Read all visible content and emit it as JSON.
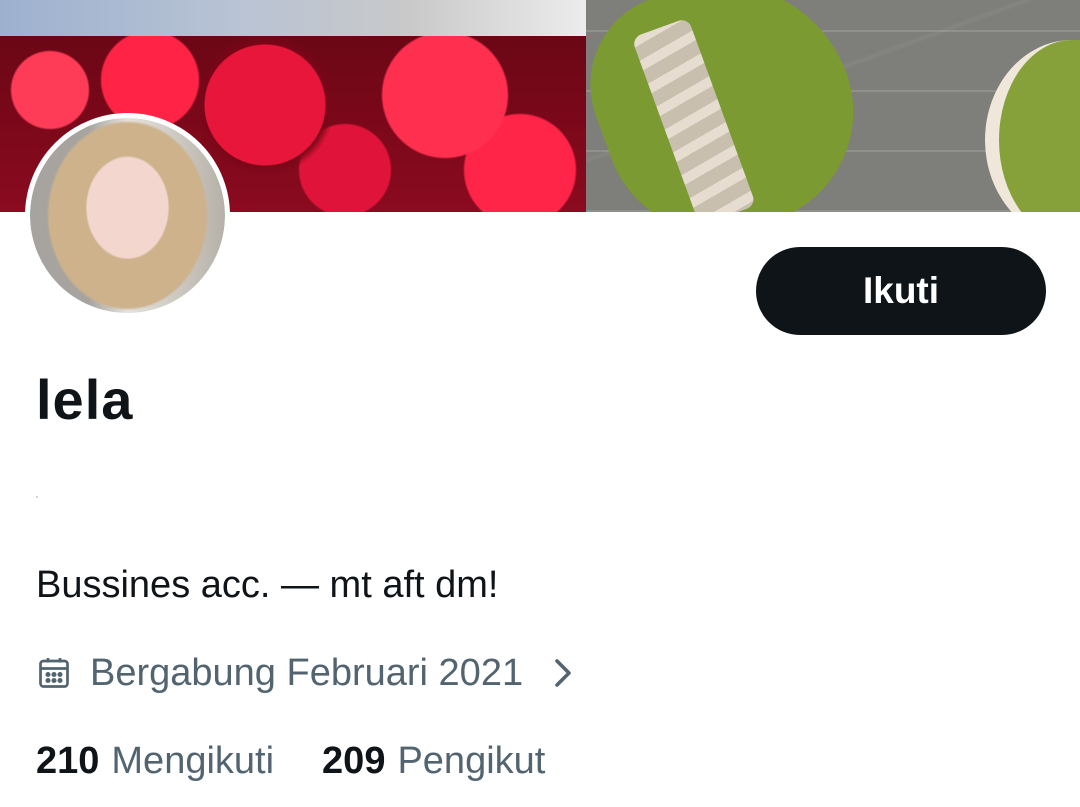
{
  "profile": {
    "display_name": "lela",
    "bio": "Bussines acc. — mt aft dm!",
    "joined": "Bergabung Februari 2021",
    "follow_label": "Ikuti"
  },
  "stats": {
    "following_count": "210",
    "following_label": "Mengikuti",
    "followers_count": "209",
    "followers_label": "Pengikut"
  },
  "icons": {
    "calendar": "calendar-icon",
    "chevron": "chevron-right-icon"
  },
  "colors": {
    "primary_text": "#0f1419",
    "secondary_text": "#536471",
    "button_bg": "#0f1419",
    "button_text": "#ffffff"
  }
}
